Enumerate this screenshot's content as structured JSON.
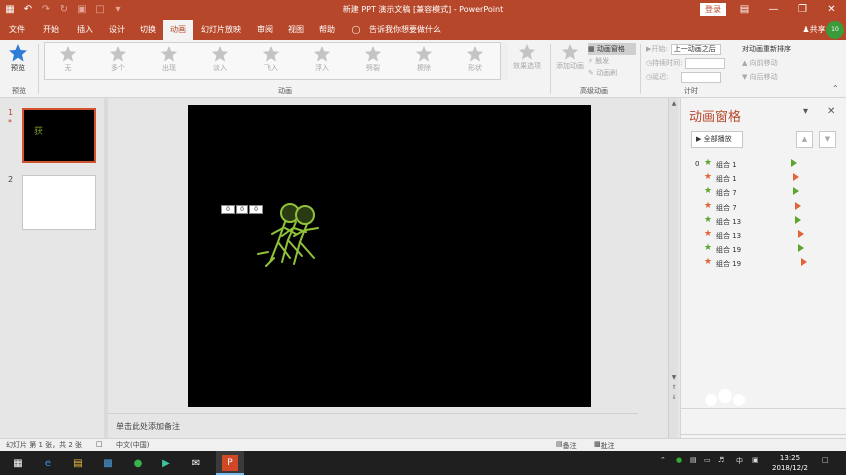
{
  "titlebar": {
    "title": "新建 PPT 演示文稿 [兼容模式] - PowerPoint",
    "login": "登录",
    "bg_color": "#b7472a"
  },
  "tabs": [
    "文件",
    "开始",
    "插入",
    "设计",
    "切换",
    "动画",
    "幻灯片放映",
    "审阅",
    "视图",
    "帮助",
    "告诉我你想要做什么"
  ],
  "active_tab": "动画",
  "share": "共享",
  "avatar": "10",
  "ribbon": {
    "preview_label": "预览",
    "preview_group": "预览",
    "gallery": [
      "无",
      "多个",
      "出现",
      "淡入",
      "飞入",
      "浮入",
      "劈裂",
      "擦除",
      "形状"
    ],
    "effect_options": "效果选项",
    "animation_group": "动画",
    "add_animation": "添加动画",
    "advanced": [
      "动画窗格",
      "触发",
      "动画刷"
    ],
    "advanced_group": "高级动画",
    "start_label": "开始:",
    "start_value": "上一动画之后",
    "duration_label": "持续时间:",
    "delay_label": "延迟:",
    "timing_group": "计时",
    "reorder_title": "对动画重新排序",
    "move_earlier": "向前移动",
    "move_later": "向后移动"
  },
  "slides": [
    {
      "num": "1",
      "marker": "*",
      "thumb_text": "获"
    },
    {
      "num": "2"
    }
  ],
  "slide_tags": [
    "0",
    "0",
    "0"
  ],
  "notes_placeholder": "单击此处添加备注",
  "anim_pane": {
    "title": "动画窗格",
    "play_all": "全部播放",
    "items": [
      {
        "num": "0",
        "name": "组合 1",
        "star_color": "#5aa52c",
        "marker": "play"
      },
      {
        "num": "",
        "name": "组合 1",
        "star_color": "#e0633a",
        "marker": "play-outline"
      },
      {
        "num": "",
        "name": "组合 7",
        "star_color": "#5aa52c",
        "marker": "play"
      },
      {
        "num": "",
        "name": "组合 7",
        "star_color": "#e0633a",
        "marker": "play-outline"
      },
      {
        "num": "",
        "name": "组合 13",
        "star_color": "#5aa52c",
        "marker": "play"
      },
      {
        "num": "",
        "name": "组合 13",
        "star_color": "#e0633a",
        "marker": "play-outline"
      },
      {
        "num": "",
        "name": "组合 19",
        "star_color": "#5aa52c",
        "marker": "play"
      },
      {
        "num": "",
        "name": "组合 19",
        "star_color": "#e0633a",
        "marker": "play-outline"
      }
    ]
  },
  "status": {
    "slide_info": "幻灯片 第 1 张，共 2 张",
    "language": "中文(中国)",
    "notes": "备注",
    "comments": "批注"
  },
  "taskbar": {
    "time": "13:25",
    "date": "2018/12/2",
    "ime": "中"
  }
}
